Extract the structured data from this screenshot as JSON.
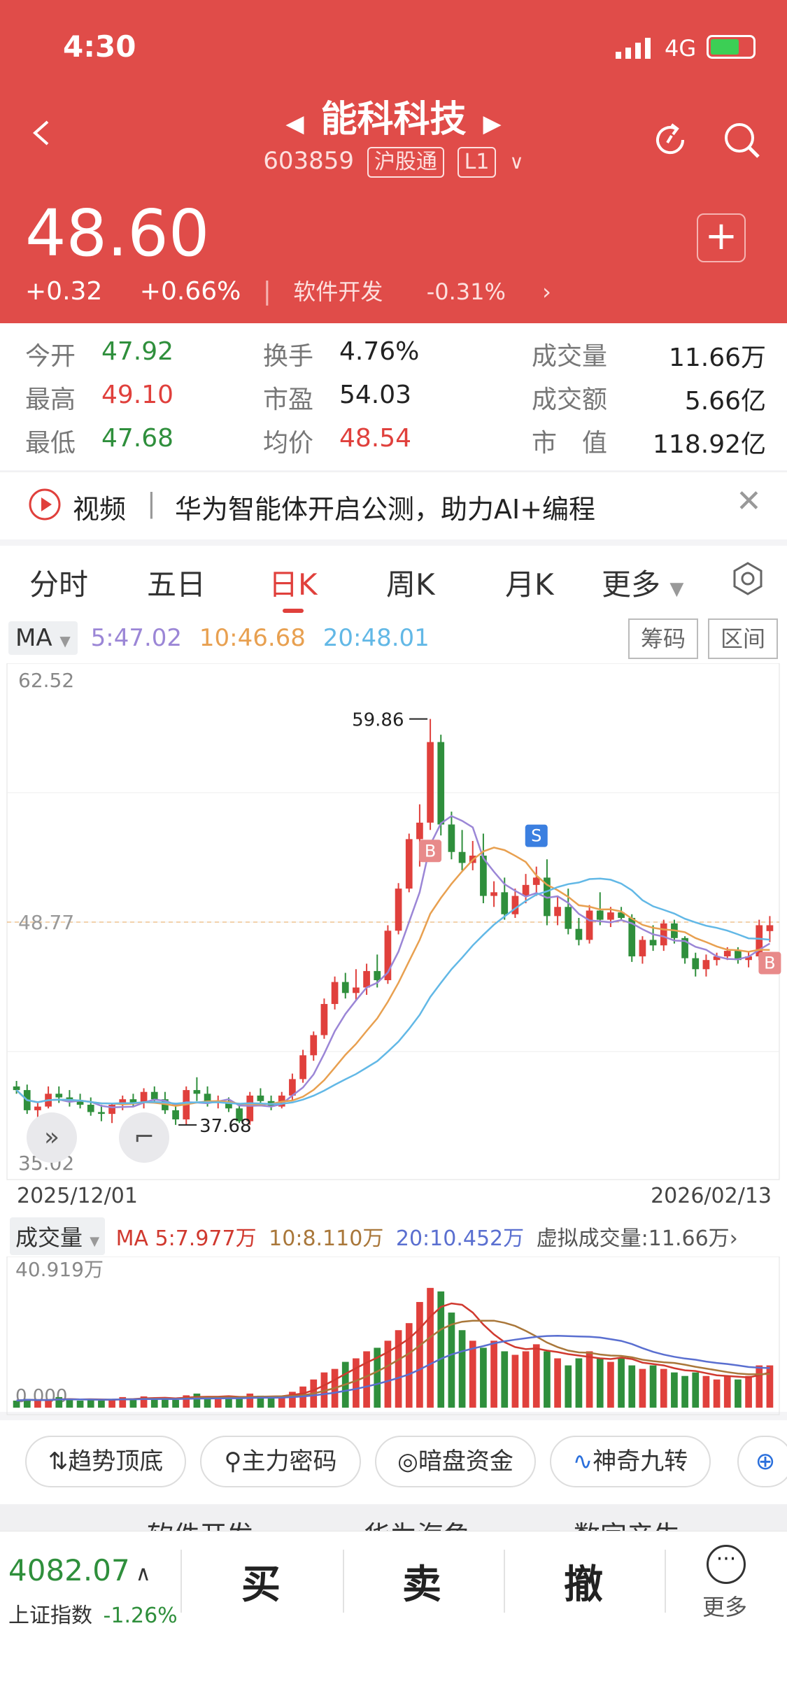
{
  "status": {
    "time": "4:30",
    "network": "4G"
  },
  "header": {
    "title": "能科科技",
    "code": "603859",
    "tag1": "沪股通",
    "tag2": "L1",
    "price": "48.60",
    "change": "+0.32",
    "change_pct": "+0.66%",
    "sector": "软件开发",
    "sector_change": "-0.31%",
    "plus": "+"
  },
  "quote": {
    "open_label": "今开",
    "open": "47.92",
    "high_label": "最高",
    "high": "49.10",
    "low_label": "最低",
    "low": "47.68",
    "turnover_label": "换手",
    "turnover": "4.76%",
    "pe_label": "市盈",
    "pe": "54.03",
    "avg_label": "均价",
    "avg": "48.54",
    "vol_label": "成交量",
    "vol": "11.66万",
    "amount_label": "成交额",
    "amount": "5.66亿",
    "cap_label": "市　值",
    "cap": "118.92亿"
  },
  "news": {
    "label": "视频",
    "text": "华为智能体开启公测，助力AI+编程"
  },
  "tabs": [
    "分时",
    "五日",
    "日K",
    "周K",
    "月K",
    "更多"
  ],
  "ma": {
    "label": "MA",
    "ma5": "5:47.02",
    "ma10": "10:46.68",
    "ma20": "20:48.01",
    "btn_chip": "筹码",
    "btn_range": "区间",
    "color_ma5": "#9b86d6",
    "color_ma10": "#e8a050",
    "color_ma20": "#62b8e6"
  },
  "chart": {
    "y_top": "62.52",
    "y_bottom": "35.02",
    "y_current": "48.77",
    "high_label": "59.86",
    "low_label": "37.68",
    "date_start": "2025/12/01",
    "date_end": "2026/02/13",
    "signal_s": "S",
    "signal_b": "B"
  },
  "volume": {
    "label": "成交量",
    "ma5": "MA 5:7.977万",
    "ma10": "10:8.110万",
    "ma20": "20:10.452万",
    "virtual": "虚拟成交量:11.66万",
    "y_top": "40.919万",
    "y_bottom": "0.000"
  },
  "tools": [
    "趋势顶底",
    "主力密码",
    "暗盘资金",
    "神奇九转"
  ],
  "subtabs": [
    "软件开发",
    "华为海角",
    "数字产生"
  ],
  "bottom": {
    "index_value": "4082.07",
    "index_name": "上证指数",
    "index_change": "-1.26%",
    "buy": "买",
    "sell": "卖",
    "cancel": "撤",
    "more": "更多"
  },
  "colors": {
    "header_bg": "#e04c49",
    "up": "#e0403c",
    "down": "#2f8f3c"
  },
  "chart_data": {
    "type": "candlestick",
    "ylim": [
      35.02,
      62.52
    ],
    "candles": [
      [
        39.8,
        40.1,
        39.4,
        39.6
      ],
      [
        39.6,
        39.9,
        38.3,
        38.5
      ],
      [
        38.5,
        38.9,
        37.9,
        38.7
      ],
      [
        38.7,
        39.8,
        38.6,
        39.4
      ],
      [
        39.4,
        39.8,
        38.9,
        39.2
      ],
      [
        39.2,
        39.6,
        38.7,
        39.0
      ],
      [
        39.0,
        39.4,
        38.6,
        38.8
      ],
      [
        38.8,
        39.2,
        38.2,
        38.4
      ],
      [
        38.4,
        38.8,
        37.9,
        38.3
      ],
      [
        38.3,
        38.9,
        37.8,
        38.8
      ],
      [
        38.8,
        39.3,
        38.5,
        39.1
      ],
      [
        39.1,
        39.4,
        38.7,
        38.9
      ],
      [
        38.9,
        39.7,
        38.6,
        39.5
      ],
      [
        39.5,
        39.8,
        38.9,
        39.1
      ],
      [
        39.1,
        39.5,
        38.3,
        38.5
      ],
      [
        38.5,
        38.9,
        37.7,
        38.0
      ],
      [
        38.0,
        39.8,
        37.7,
        39.6
      ],
      [
        39.6,
        40.3,
        39.0,
        39.4
      ],
      [
        39.4,
        39.8,
        38.7,
        38.9
      ],
      [
        38.9,
        39.3,
        38.6,
        39.0
      ],
      [
        39.0,
        39.2,
        38.4,
        38.6
      ],
      [
        38.6,
        38.9,
        37.8,
        37.9
      ],
      [
        37.9,
        39.5,
        37.7,
        39.3
      ],
      [
        39.3,
        39.7,
        38.8,
        39.0
      ],
      [
        39.0,
        39.3,
        38.5,
        38.7
      ],
      [
        38.7,
        39.5,
        38.6,
        39.3
      ],
      [
        39.3,
        40.5,
        39.0,
        40.2
      ],
      [
        40.2,
        41.8,
        40.0,
        41.5
      ],
      [
        41.5,
        42.8,
        41.2,
        42.6
      ],
      [
        42.6,
        44.6,
        42.4,
        44.3
      ],
      [
        44.3,
        45.8,
        44.0,
        45.5
      ],
      [
        45.5,
        46.0,
        44.6,
        44.9
      ],
      [
        44.9,
        46.2,
        44.5,
        45.2
      ],
      [
        45.2,
        46.5,
        44.8,
        46.1
      ],
      [
        46.1,
        47.0,
        45.2,
        45.6
      ],
      [
        45.6,
        48.6,
        45.4,
        48.3
      ],
      [
        48.3,
        50.9,
        48.1,
        50.6
      ],
      [
        50.6,
        53.6,
        50.4,
        53.3
      ],
      [
        53.3,
        55.2,
        51.8,
        54.2
      ],
      [
        54.2,
        59.86,
        53.8,
        58.6
      ],
      [
        58.6,
        59.0,
        53.5,
        54.1
      ],
      [
        54.1,
        54.8,
        52.2,
        52.6
      ],
      [
        52.6,
        53.8,
        51.6,
        52.0
      ],
      [
        52.0,
        53.2,
        51.6,
        52.4
      ],
      [
        52.4,
        53.6,
        49.8,
        50.2
      ],
      [
        50.2,
        51.0,
        49.6,
        50.4
      ],
      [
        50.4,
        51.2,
        48.9,
        49.2
      ],
      [
        49.2,
        50.6,
        49.0,
        50.2
      ],
      [
        50.2,
        51.4,
        49.8,
        50.8
      ],
      [
        50.8,
        51.8,
        50.2,
        51.2
      ],
      [
        51.2,
        52.2,
        48.6,
        49.1
      ],
      [
        49.1,
        50.2,
        48.6,
        49.6
      ],
      [
        49.6,
        50.6,
        48.1,
        48.4
      ],
      [
        48.4,
        49.0,
        47.5,
        47.8
      ],
      [
        47.8,
        49.7,
        47.6,
        49.4
      ],
      [
        49.4,
        50.4,
        48.6,
        48.9
      ],
      [
        48.9,
        49.6,
        48.5,
        49.3
      ],
      [
        49.3,
        49.6,
        48.9,
        49.0
      ],
      [
        49.0,
        49.2,
        46.6,
        46.9
      ],
      [
        46.9,
        48.0,
        46.5,
        47.8
      ],
      [
        47.8,
        48.6,
        47.2,
        47.5
      ],
      [
        47.5,
        48.9,
        47.2,
        48.7
      ],
      [
        48.7,
        48.9,
        47.6,
        47.9
      ],
      [
        47.9,
        48.0,
        46.5,
        46.8
      ],
      [
        46.8,
        47.1,
        45.8,
        46.2
      ],
      [
        46.2,
        47.0,
        45.8,
        46.7
      ],
      [
        46.7,
        47.1,
        46.4,
        46.9
      ],
      [
        46.9,
        47.4,
        46.7,
        47.2
      ],
      [
        47.2,
        47.4,
        46.5,
        46.7
      ],
      [
        46.7,
        47.2,
        46.3,
        46.9
      ],
      [
        46.9,
        48.9,
        46.7,
        48.6
      ],
      [
        48.28,
        49.1,
        47.68,
        48.6
      ]
    ],
    "volume_ylim": [
      0,
      40.919
    ],
    "volumes": [
      2,
      2.5,
      2,
      2.2,
      3,
      2.5,
      2,
      2.2,
      2,
      2.5,
      3,
      2.4,
      3.2,
      2.6,
      2.8,
      2.2,
      3.5,
      4,
      3,
      2.8,
      3,
      2.5,
      4,
      3.4,
      3,
      3.2,
      4.5,
      6,
      8,
      10,
      11,
      13,
      14,
      16,
      17,
      19,
      22,
      24,
      30,
      34,
      33,
      27,
      22,
      19,
      17,
      19,
      16,
      15,
      16,
      18,
      16,
      14,
      12,
      14,
      16,
      14,
      13,
      14,
      12,
      11,
      12,
      11,
      10,
      9,
      10,
      9,
      8,
      9,
      8,
      9,
      12,
      12
    ]
  }
}
